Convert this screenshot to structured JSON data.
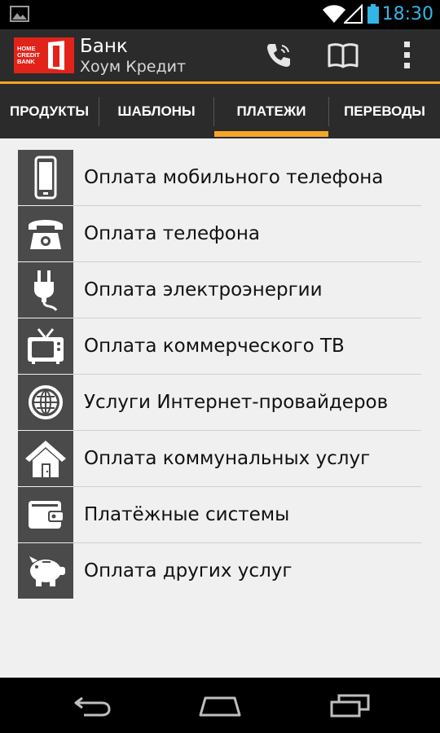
{
  "status_bar": {
    "time": "18:30"
  },
  "header": {
    "logo_lines": [
      "HOME",
      "CREDIT",
      "BANK"
    ],
    "title": "Банк",
    "subtitle": "Хоум Кредит"
  },
  "actions": [
    {
      "name": "call-action",
      "icon": "phone-icon"
    },
    {
      "name": "guide-action",
      "icon": "book-icon"
    },
    {
      "name": "overflow-menu",
      "icon": "more-vert-icon"
    }
  ],
  "tabs": [
    {
      "label": "ПРОДУКТЫ",
      "selected": false
    },
    {
      "label": "ШАБЛОНЫ",
      "selected": false
    },
    {
      "label": "ПЛАТЕЖИ",
      "selected": true
    },
    {
      "label": "ПЕРЕВОДЫ",
      "selected": false
    }
  ],
  "payments": [
    {
      "label": "Оплата мобильного телефона",
      "icon": "mobile-phone-icon"
    },
    {
      "label": "Оплата телефона",
      "icon": "landline-phone-icon"
    },
    {
      "label": "Оплата электроэнергии",
      "icon": "power-plug-icon"
    },
    {
      "label": "Оплата коммерческого ТВ",
      "icon": "tv-icon"
    },
    {
      "label": "Услуги Интернет-провайдеров",
      "icon": "globe-icon"
    },
    {
      "label": "Оплата коммунальных услуг",
      "icon": "house-icon"
    },
    {
      "label": "Платёжные системы",
      "icon": "wallet-icon"
    },
    {
      "label": "Оплата других услуг",
      "icon": "piggy-bank-icon"
    }
  ],
  "colors": {
    "accent": "#f5a623",
    "bar": "#2b2b2b",
    "icon_bg": "#4a4a4a",
    "clock": "#33b5e5"
  }
}
